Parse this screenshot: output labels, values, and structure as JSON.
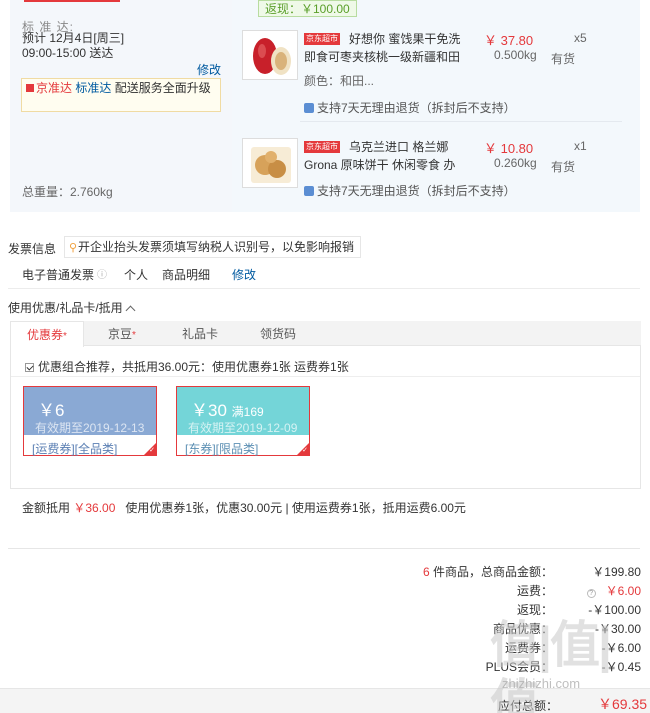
{
  "shipping": {
    "label": "标 准 达:",
    "estimate": "预计 12月4日[周三] 09:00-15:00 送达",
    "modify": "修改",
    "jzd_tag": "京准达",
    "jzd_link": "标准达",
    "jzd_text": "配送服务全面升级",
    "total_weight": "总重量：2.760kg"
  },
  "rebate": "返现：￥100.00",
  "items": [
    {
      "store_tag": "京东超市",
      "title_line1": "好想你 蜜饯果干免洗",
      "title_line2": "即食可枣夹核桃一级新疆和田",
      "color": "颜色：和田...",
      "price": "￥ 37.80",
      "weight": "0.500kg",
      "qty": "x5",
      "stock": "有货",
      "support": "支持7天无理由退货（拆封后不支持）"
    },
    {
      "store_tag": "京东超市",
      "title_line1": "乌克兰进口 格兰娜",
      "title_line2": "Grona 原味饼干 休闲零食 办",
      "price": "￥ 10.80",
      "weight": "0.260kg",
      "qty": "x1",
      "stock": "有货",
      "support": "支持7天无理由退货（拆封后不支持）"
    }
  ],
  "invoice": {
    "title": "发票信息",
    "tip": "开企业抬头发票须填写纳税人识别号，以免影响报销",
    "type": "电子普通发票",
    "personal": "个人",
    "detail": "商品明细",
    "modify": "修改"
  },
  "coupons": {
    "header": "使用优惠/礼品卡/抵用",
    "tabs": [
      "优惠券",
      "京豆",
      "礼品卡",
      "领货码"
    ],
    "recommend": "优惠组合推荐，共抵用36.00元：使用优惠券1张 运费券1张",
    "cards": [
      {
        "amount": "￥6",
        "valid": "有效期至2019-12-13",
        "tags": "[运费券][全品类]",
        "color": "#8aa9d4"
      },
      {
        "amount": "￥30",
        "threshold": "满169",
        "valid": "有效期至2019-12-09",
        "tags": "[东券][限品类]",
        "color": "#74d5d8"
      }
    ],
    "deduct_label": "金额抵用",
    "deduct_value": "￥36.00",
    "deduct_detail": "使用优惠券1张，优惠30.00元 | 使用运费券1张，抵用运费6.00元"
  },
  "summary": {
    "count": "6",
    "count_suffix": "件商品，总商品金额：",
    "total": "￥199.80",
    "freight_label": "运费：",
    "freight": "￥6.00",
    "rebate_label": "返现：",
    "rebate": "-￥100.00",
    "discount_label": "商品优惠：",
    "discount": "-￥30.00",
    "freight_coupon_label": "运费券：",
    "freight_coupon": "-￥6.00",
    "plus_label": "PLUS会员：",
    "plus": "-￥0.45",
    "pay_label": "应付总额：",
    "pay": "￥69.35"
  },
  "watermark": {
    "big": "值|值|值",
    "small": "zhizhizhi.com"
  }
}
